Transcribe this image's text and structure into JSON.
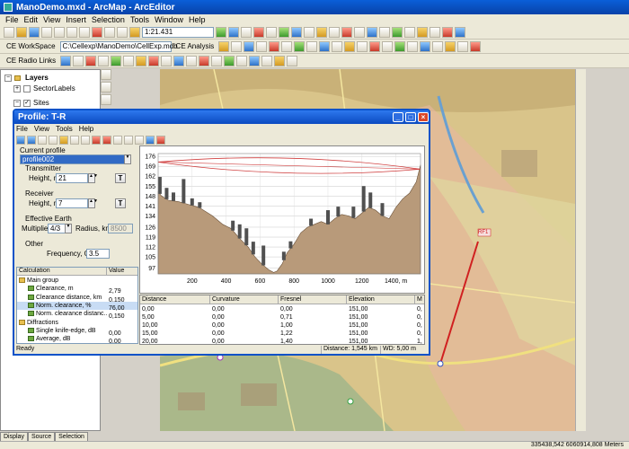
{
  "window": {
    "title": "ManoDemo.mxd - ArcMap - ArcEditor"
  },
  "menu": [
    "File",
    "Edit",
    "View",
    "Insert",
    "Selection",
    "Tools",
    "Window",
    "Help"
  ],
  "toolbar": {
    "scale": "1:21.431",
    "workspace_label": "CE WorkSpace",
    "db_path": "C:\\Cellexp\\ManoDemo\\CellExp.mdb",
    "analysis_label": "CE Analysis",
    "radio_links_label": "CE Radio Links"
  },
  "toc": {
    "root": "Layers",
    "items": [
      "SectorLabels",
      "Sites"
    ],
    "tabs": [
      "Display",
      "Source",
      "Selection"
    ]
  },
  "profile": {
    "title": "Profile: T-R",
    "menu": [
      "File",
      "View",
      "Tools",
      "Help"
    ],
    "current_profile_label": "Current profile",
    "current_profile": "profile002",
    "transmitter_label": "Transmitter",
    "tx_height_label": "Height, m",
    "tx_height": "21",
    "receiver_label": "Receiver",
    "rx_height_label": "Height, m",
    "rx_height": "7",
    "t_button": "T",
    "earth_label": "Effective Earth",
    "multiplier_label": "Multiplier",
    "multiplier": "4/3",
    "radius_label": "Radius, km",
    "radius": "8500",
    "other_label": "Other",
    "freq_label": "Frequency, GHz",
    "freq": "3.5",
    "calc_headers": [
      "Calculation",
      "Value"
    ],
    "calc_rows": [
      {
        "name": "Main group",
        "value": "",
        "level": 1,
        "group": true
      },
      {
        "name": "Clearance, m",
        "value": "2,79",
        "level": 2
      },
      {
        "name": "Clearance distance, km",
        "value": "0,150",
        "level": 2
      },
      {
        "name": "Norm. clearance, %",
        "value": "76,00",
        "level": 2,
        "selected": true
      },
      {
        "name": "Norm. clearance distanc...",
        "value": "0,150",
        "level": 2
      },
      {
        "name": "Diffractions",
        "value": "",
        "level": 1,
        "group": true
      },
      {
        "name": "Single knife-edge, dB",
        "value": "0,00",
        "level": 2
      },
      {
        "name": "Average, dB",
        "value": "0,00",
        "level": 2
      }
    ],
    "grid_headers": [
      "Distance",
      "Curvature",
      "Fresnel",
      "Elevation",
      "M"
    ],
    "grid_rows": [
      [
        "0,00",
        "0,00",
        "0,00",
        "151,00",
        "0,"
      ],
      [
        "5,00",
        "0,00",
        "0,71",
        "151,00",
        "0,"
      ],
      [
        "10,00",
        "0,00",
        "1,00",
        "151,00",
        "0,"
      ],
      [
        "15,00",
        "0,00",
        "1,22",
        "151,00",
        "0,"
      ],
      [
        "20,00",
        "0,00",
        "1,40",
        "151,00",
        "1,"
      ]
    ],
    "status_left": "Ready",
    "status_distance": "Distance: 1,545 km",
    "status_wd": "WD: 5,00 m"
  },
  "map": {
    "site_label": "RF1"
  },
  "status_bar": {
    "coords": "335438,542  6060914,808 Meters"
  },
  "colors": {
    "title_blue": "#0a5fd8",
    "terrain": "#b89a7a",
    "fresnel": "#d04040",
    "link_line": "#d02020"
  },
  "chart_data": {
    "type": "area",
    "title": "",
    "xlabel": "",
    "ylabel": "",
    "xticks": [
      200,
      400,
      600,
      800,
      1000,
      1200,
      "1400, m"
    ],
    "yticks": [
      97,
      105,
      112,
      119,
      126,
      134,
      141,
      148,
      155,
      162,
      169,
      176
    ],
    "xlim": [
      0,
      1545
    ],
    "ylim": [
      93,
      178
    ],
    "terrain": {
      "x": [
        0,
        20,
        60,
        120,
        180,
        240,
        280,
        320,
        380,
        430,
        480,
        530,
        570,
        610,
        650,
        680,
        700,
        730,
        760,
        800,
        840,
        880,
        920,
        960,
        1000,
        1040,
        1080,
        1120,
        1160,
        1200,
        1240,
        1280,
        1320,
        1360,
        1400,
        1440,
        1480,
        1520,
        1545
      ],
      "y": [
        151,
        148,
        145,
        144,
        142,
        140,
        137,
        134,
        128,
        125,
        118,
        112,
        105,
        100,
        96,
        94,
        95,
        100,
        108,
        114,
        122,
        126,
        128,
        130,
        128,
        132,
        135,
        134,
        132,
        136,
        140,
        138,
        134,
        132,
        140,
        146,
        150,
        158,
        170
      ]
    },
    "clutter": [
      {
        "x": 10,
        "h": 12
      },
      {
        "x": 50,
        "h": 8
      },
      {
        "x": 90,
        "h": 6
      },
      {
        "x": 150,
        "h": 17
      },
      {
        "x": 200,
        "h": 5
      },
      {
        "x": 245,
        "h": 4
      },
      {
        "x": 440,
        "h": 7
      },
      {
        "x": 480,
        "h": 10
      },
      {
        "x": 520,
        "h": 12
      },
      {
        "x": 560,
        "h": 9
      },
      {
        "x": 620,
        "h": 14
      },
      {
        "x": 740,
        "h": 6
      },
      {
        "x": 780,
        "h": 5
      },
      {
        "x": 900,
        "h": 5
      },
      {
        "x": 1000,
        "h": 10
      },
      {
        "x": 1060,
        "h": 7
      },
      {
        "x": 1150,
        "h": 8
      },
      {
        "x": 1210,
        "h": 18
      },
      {
        "x": 1250,
        "h": 11
      },
      {
        "x": 1320,
        "h": 9
      }
    ],
    "los": {
      "x": [
        0,
        1545
      ],
      "y": [
        172,
        167
      ]
    },
    "fresnel_outer": {
      "y_top": [
        176,
        171
      ],
      "y_bottom": [
        168,
        163
      ]
    }
  }
}
